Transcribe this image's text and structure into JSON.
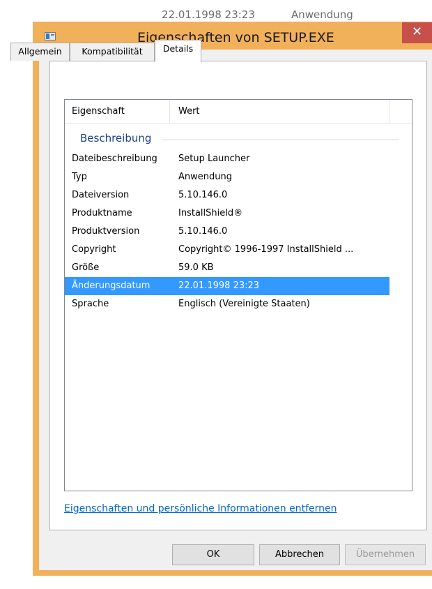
{
  "background_file_row": {
    "date": "22.01.1998 23:23",
    "type": "Anwendung"
  },
  "window": {
    "title": "Eigenschaften von SETUP.EXE",
    "close_symbol": "✕"
  },
  "tabs": [
    {
      "label": "Allgemein",
      "active": false
    },
    {
      "label": "Kompatibilität",
      "active": false
    },
    {
      "label": "Details",
      "active": true
    }
  ],
  "list": {
    "columns": [
      "Eigenschaft",
      "Wert"
    ],
    "group_label": "Beschreibung",
    "rows": [
      {
        "property": "Dateibeschreibung",
        "value": "Setup Launcher"
      },
      {
        "property": "Typ",
        "value": "Anwendung"
      },
      {
        "property": "Dateiversion",
        "value": "5.10.146.0"
      },
      {
        "property": "Produktname",
        "value": "InstallShield®"
      },
      {
        "property": "Produktversion",
        "value": "5.10.146.0"
      },
      {
        "property": "Copyright",
        "value": "Copyright© 1996-1997 InstallShield ..."
      },
      {
        "property": "Größe",
        "value": "59.0 KB"
      },
      {
        "property": "Änderungsdatum",
        "value": "22.01.1998 23:23",
        "selected": true
      },
      {
        "property": "Sprache",
        "value": "Englisch (Vereinigte Staaten)"
      }
    ]
  },
  "remove_link": "Eigenschaften und persönliche Informationen entfernen",
  "buttons": {
    "ok": "OK",
    "cancel": "Abbrechen",
    "apply": "Übernehmen"
  },
  "colors": {
    "frame": "#f1b05a",
    "close_button": "#c7504a",
    "selection": "#3399ff",
    "link": "#0066cc",
    "group_label": "#1e3f8c"
  }
}
